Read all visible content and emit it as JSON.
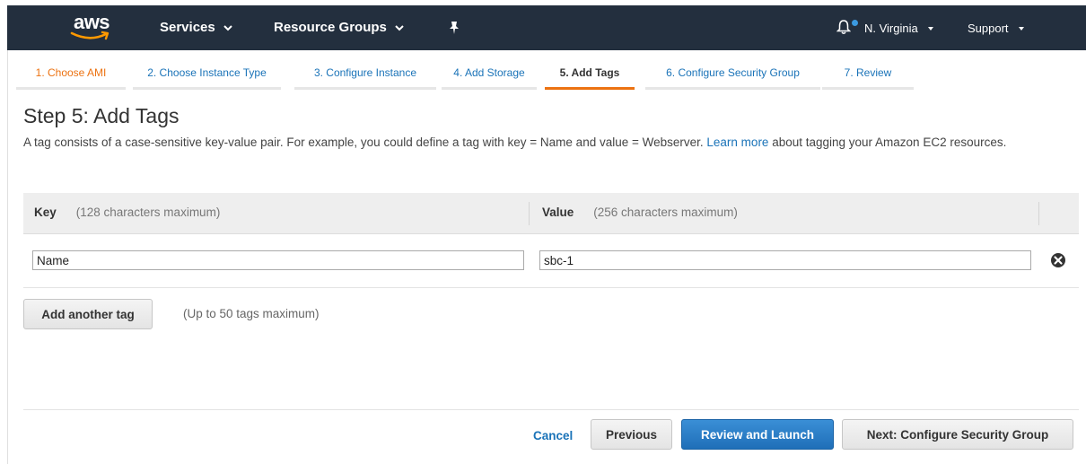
{
  "nav": {
    "logo": "aws",
    "services": "Services",
    "resource_groups": "Resource Groups",
    "region": "N. Virginia",
    "support": "Support"
  },
  "wizard": {
    "tabs": [
      {
        "label": "1. Choose AMI",
        "state": "done"
      },
      {
        "label": "2. Choose Instance Type",
        "state": "link"
      },
      {
        "label": "3. Configure Instance",
        "state": "link"
      },
      {
        "label": "4. Add Storage",
        "state": "link"
      },
      {
        "label": "5. Add Tags",
        "state": "active"
      },
      {
        "label": "6. Configure Security Group",
        "state": "link"
      },
      {
        "label": "7. Review",
        "state": "link"
      }
    ]
  },
  "page": {
    "title": "Step 5: Add Tags",
    "desc_before": "A tag consists of a case-sensitive key-value pair. For example, you could define a tag with key = Name and value = Webserver. ",
    "desc_link": "Learn more",
    "desc_after": " about tagging your Amazon EC2 resources."
  },
  "table": {
    "key_header": "Key",
    "key_hint": "(128 characters maximum)",
    "value_header": "Value",
    "value_hint": "(256 characters maximum)",
    "rows": [
      {
        "key": "Name",
        "value": "sbc-1"
      }
    ]
  },
  "add_tag": {
    "button": "Add another tag",
    "hint": "(Up to 50 tags maximum)"
  },
  "footer": {
    "cancel": "Cancel",
    "previous": "Previous",
    "review_launch": "Review and Launch",
    "next": "Next: Configure Security Group"
  },
  "colors": {
    "nav_bg": "#232f3e",
    "accent_orange": "#ec7211",
    "link_blue": "#1a73b8",
    "primary_blue": "#1f6fb8"
  },
  "icons": [
    "caret-down-icon",
    "pin-icon",
    "bell-icon",
    "remove-circle-icon"
  ]
}
